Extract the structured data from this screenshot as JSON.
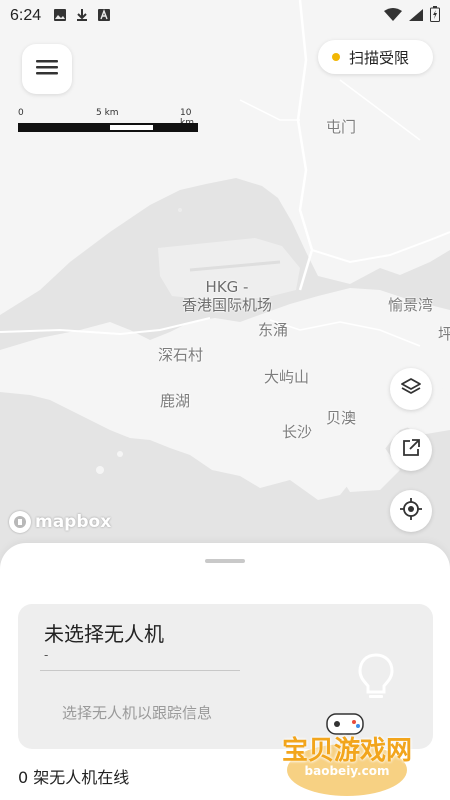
{
  "status_bar": {
    "time": "6:24",
    "icons": [
      "image-icon",
      "download-icon",
      "a-icon"
    ],
    "right_icons": [
      "wifi-icon",
      "signal-icon",
      "battery-icon"
    ]
  },
  "menu": {
    "icon": "hamburger-menu-icon"
  },
  "scan": {
    "label": "扫描受限",
    "dot_color": "#f2b705"
  },
  "scale": {
    "ticks": [
      "0",
      "5 km",
      "10 km"
    ]
  },
  "map": {
    "labels": {
      "tuen_mun": "屯门",
      "hkg_code": "HKG -",
      "hkg_name": "香港国际机场",
      "tung_chung": "东涌",
      "sham_shek_tsuen": "深石村",
      "tai_yue_shan": "大屿山",
      "luk_wu": "鹿湖",
      "pui_o": "贝澳",
      "cheung_sha": "长沙",
      "discovery_bay": "愉景湾",
      "peng_chau": "坪"
    },
    "colors": {
      "water": "#e4e4e4",
      "land": "#f5f5f5",
      "road": "#ffffff"
    }
  },
  "fabs": {
    "layers_icon": "layers-icon",
    "share_icon": "share-icon",
    "locate_icon": "locate-icon"
  },
  "mapbox": {
    "logo_text": "mapbox"
  },
  "sheet": {
    "card": {
      "title": "未选择无人机",
      "subtitle": "-",
      "hint": "选择无人机以跟踪信息"
    },
    "online_count": "0 架无人机在线"
  },
  "watermark": {
    "text": "宝贝游戏网",
    "url": "baobeiy.com"
  }
}
